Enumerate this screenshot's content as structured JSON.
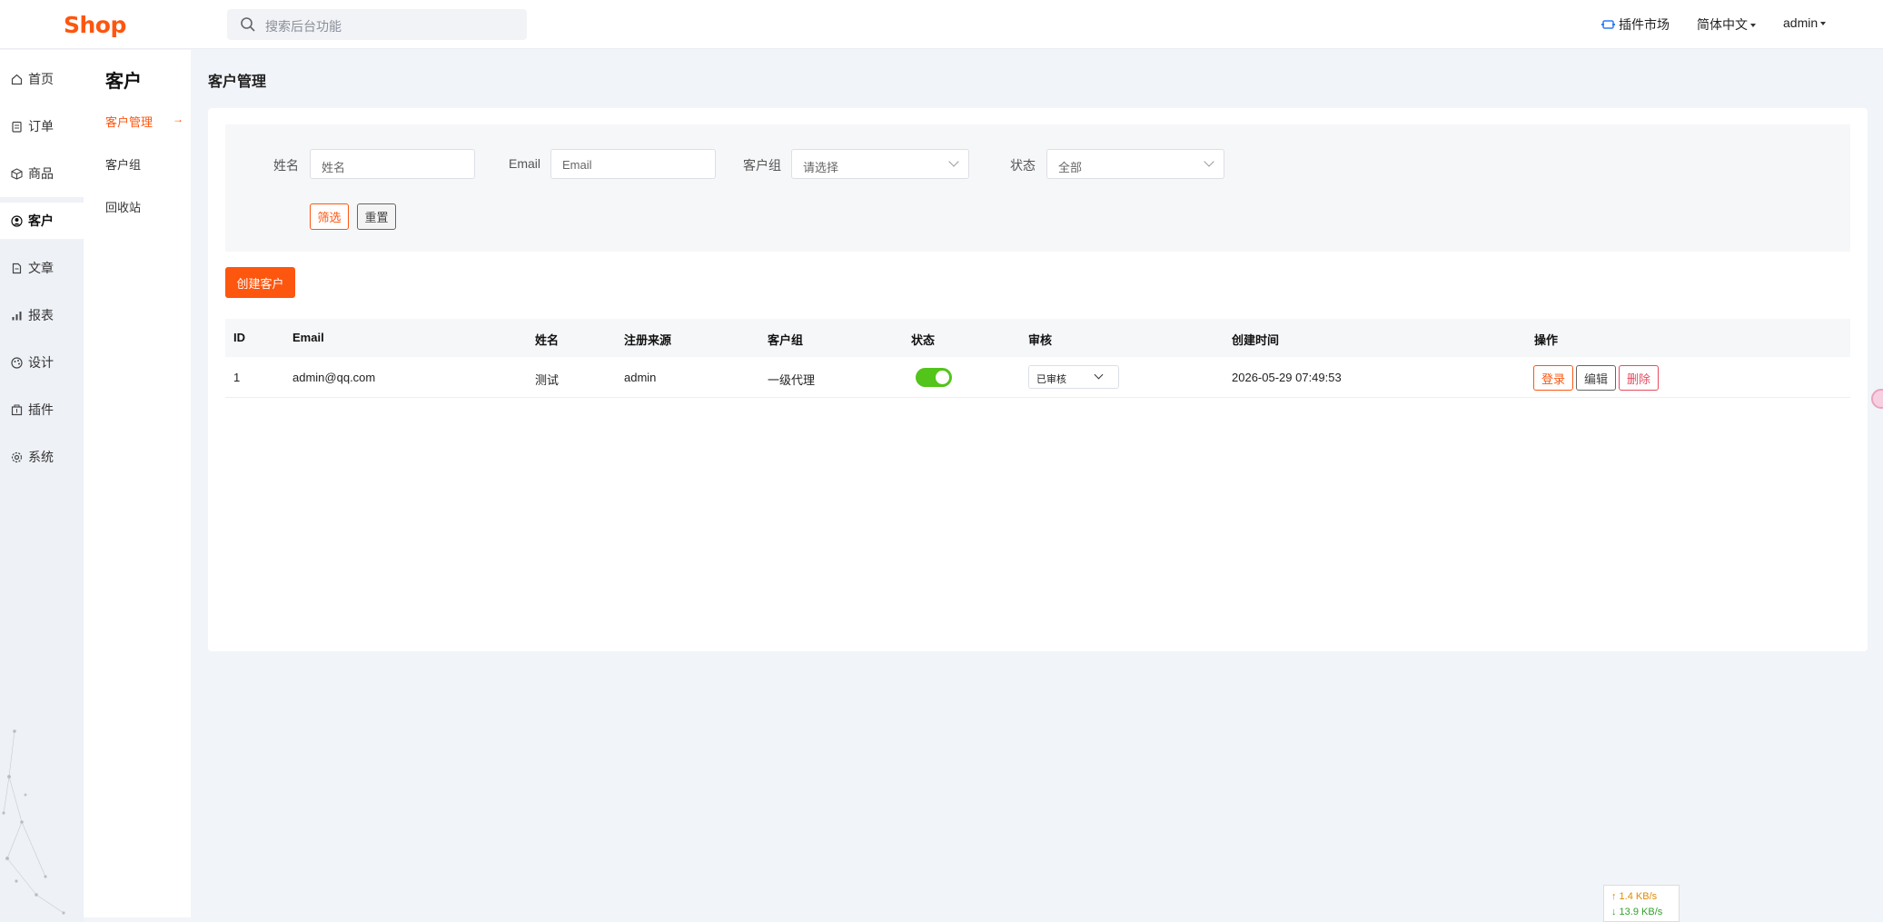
{
  "header": {
    "logo": "Shop",
    "search_placeholder": "搜索后台功能",
    "plugin_market": "插件市场",
    "language": "简体中文",
    "user": "admin"
  },
  "rail": {
    "items": [
      {
        "label": "首页",
        "icon": "home-icon"
      },
      {
        "label": "订单",
        "icon": "order-icon"
      },
      {
        "label": "商品",
        "icon": "box-icon"
      },
      {
        "label": "客户",
        "icon": "user-icon",
        "active": true
      },
      {
        "label": "文章",
        "icon": "document-icon"
      },
      {
        "label": "报表",
        "icon": "bar-chart-icon"
      },
      {
        "label": "设计",
        "icon": "palette-icon"
      },
      {
        "label": "插件",
        "icon": "plugin-icon"
      },
      {
        "label": "系统",
        "icon": "gear-icon"
      }
    ]
  },
  "subnav": {
    "title": "客户",
    "items": [
      {
        "label": "客户管理",
        "active": true
      },
      {
        "label": "客户组"
      },
      {
        "label": "回收站"
      }
    ]
  },
  "page": {
    "title": "客户管理"
  },
  "filter": {
    "name_label": "姓名",
    "name_placeholder": "姓名",
    "email_label": "Email",
    "email_placeholder": "Email",
    "group_label": "客户组",
    "group_value": "请选择",
    "status_label": "状态",
    "status_value": "全部",
    "filter_button": "筛选",
    "reset_button": "重置"
  },
  "create_button": "创建客户",
  "table": {
    "columns": [
      "ID",
      "Email",
      "姓名",
      "注册来源",
      "客户组",
      "状态",
      "审核",
      "创建时间",
      "操作"
    ],
    "rows": [
      {
        "id": "1",
        "email": "admin@qq.com",
        "name": "测试",
        "source": "admin",
        "group": "一级代理",
        "status_enabled": true,
        "audit": "已审核",
        "created": "2026-05-29 07:49:53",
        "actions": {
          "login": "登录",
          "edit": "编辑",
          "delete": "删除"
        }
      }
    ]
  },
  "netspeed": {
    "up": "↑ 1.4 KB/s",
    "down": "↓ 13.9 KB/s"
  },
  "colors": {
    "accent": "#fd560f",
    "success": "#52c41a",
    "danger": "#e84a5f"
  }
}
